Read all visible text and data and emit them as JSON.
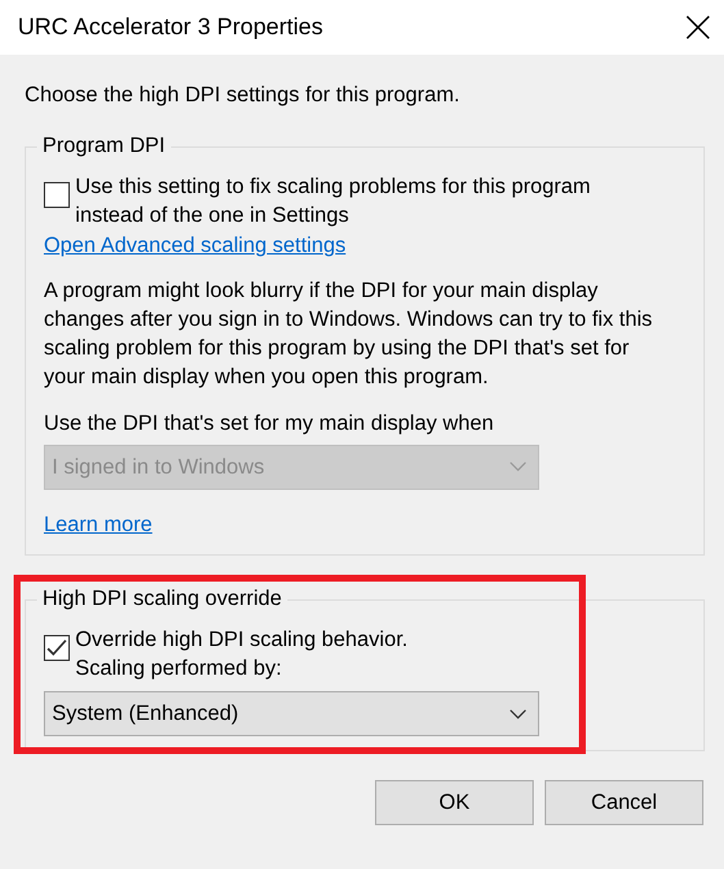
{
  "window": {
    "title": "URC Accelerator 3 Properties"
  },
  "intro": "Choose the high DPI settings for this program.",
  "groups": [
    {
      "title": "Program DPI",
      "highlighted": false,
      "items": [
        {
          "kind": "checkbox",
          "label": "Use this setting to fix scaling problems for this program\ninstead of the one in Settings",
          "checked": false
        },
        {
          "kind": "link",
          "label": "Open Advanced scaling settings"
        },
        {
          "kind": "paragraph",
          "text": "A program might look blurry if the DPI for your main display changes after you sign in to Windows. Windows can try to fix this scaling problem for this program by using the DPI that's set for your main display when you open this program."
        },
        {
          "kind": "label",
          "text": "Use the DPI that's set for my main display when"
        },
        {
          "kind": "select",
          "value": "I signed in to Windows",
          "disabled": true
        },
        {
          "kind": "link",
          "label": "Learn more"
        }
      ]
    },
    {
      "title": "High DPI scaling override",
      "highlighted": true,
      "items": [
        {
          "kind": "checkbox",
          "label": "Override high DPI scaling behavior.\nScaling performed by:",
          "checked": true
        },
        {
          "kind": "select",
          "value": "System (Enhanced)",
          "disabled": false
        }
      ]
    }
  ],
  "buttons": [
    "OK",
    "Cancel"
  ]
}
